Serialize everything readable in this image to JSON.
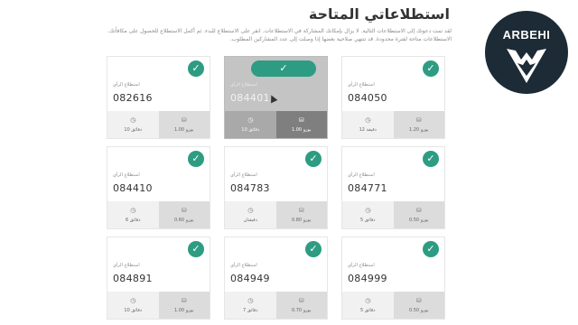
{
  "page": {
    "title": "استطلاعاتي المتاحة",
    "intro_line1": "لقد تمت دعوتك إلى الاستطلاعات التالية. لا يزال بإمكانك المشاركة في الاستطلاعات. انقر على الاستطلاع للبدء. ثم أكمل الاستطلاع للحصول على مكافأتك.",
    "intro_line2": "الاستطلاعات متاحة لفترة محدودة. قد تنتهي صلاحية بعضها إذا وصلت إلى عدد المشاركين المطلوب."
  },
  "logo": {
    "text": "ARBEHI",
    "bg_color": "#1c2b36"
  },
  "colors": {
    "accent": "#2e9c82",
    "hover_card": "#c4c4c4",
    "footer_time": "#f1f1f1",
    "footer_reward": "#dcdcdc"
  },
  "icons": {
    "check": "check-circle-icon",
    "time": "clock-icon",
    "reward": "coins-icon"
  },
  "surveys": [
    {
      "category": "استطلاع الرأي",
      "id": "082616",
      "time": "دقائق 10",
      "reward": "يورو 1.00",
      "state": "normal"
    },
    {
      "category": "استطلاع الرأي",
      "id": "084401",
      "time": "دقائق 10",
      "reward": "يورو 1.00",
      "state": "hover"
    },
    {
      "category": "استطلاع الرأي",
      "id": "084050",
      "time": "دقيقة 12",
      "reward": "يورو 1.20",
      "state": "normal"
    },
    {
      "category": "استطلاع الرأي",
      "id": "084410",
      "time": "دقائق 6",
      "reward": "يورو 0.60",
      "state": "normal"
    },
    {
      "category": "استطلاع الرأي",
      "id": "084783",
      "time": "دقيقتان",
      "reward": "يورو 0.80",
      "state": "normal"
    },
    {
      "category": "استطلاع الرأي",
      "id": "084771",
      "time": "دقائق 5",
      "reward": "يورو 0.50",
      "state": "normal"
    },
    {
      "category": "استطلاع الرأي",
      "id": "084891",
      "time": "دقائق 10",
      "reward": "يورو 1.00",
      "state": "normal"
    },
    {
      "category": "استطلاع الرأي",
      "id": "084949",
      "time": "دقائق 7",
      "reward": "يورو 0.70",
      "state": "normal"
    },
    {
      "category": "استطلاع الرأي",
      "id": "084999",
      "time": "دقائق 5",
      "reward": "يورو 0.50",
      "state": "normal"
    }
  ]
}
